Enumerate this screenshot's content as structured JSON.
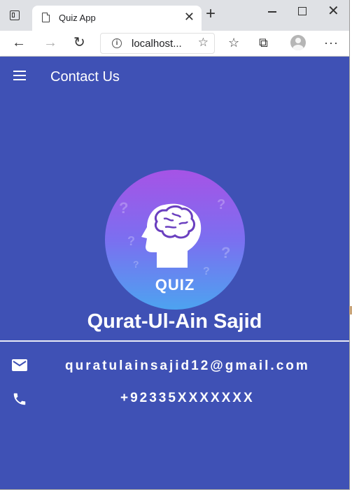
{
  "browser": {
    "tab_title": "Quiz App",
    "tab_close": "✕",
    "new_tab": "+",
    "url": "localhost...",
    "window_close": "✕",
    "more": "···"
  },
  "app": {
    "title": "Contact Us",
    "logo_text": "QUIZ",
    "name": "Qurat-Ul-Ain Sajid",
    "email": "quratulainsajid12@gmail.com",
    "phone": "+92335XXXXXXX",
    "colors": {
      "primary": "#3f51b5",
      "logo_top": "#a653e6",
      "logo_bottom": "#4da3f0"
    }
  }
}
